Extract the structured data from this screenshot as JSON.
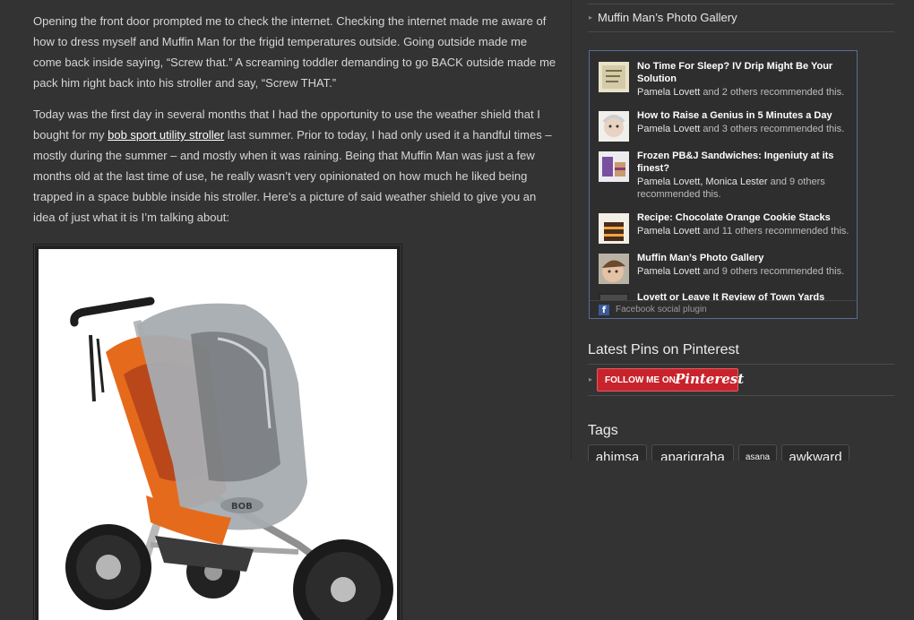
{
  "article": {
    "p1": "Opening the front door prompted me to check the internet.  Checking the internet made me aware of how to dress myself and Muffin Man for the frigid temperatures outside.  Going outside made me come back inside saying, “Screw that.” A screaming toddler demanding to go BACK outside made me pack him right back into his stroller and say, “Screw THAT.”",
    "p2_before": "Today was the first day in several months that I had the opportunity to use the weather shield that I bought for my ",
    "p2_link": "bob sport utility stroller",
    "p2_after": " last summer.  Prior to today, I had only used it a handful times – mostly during the summer – and mostly when it was raining.  Being that Muffin Man was just a few months old at the last time of use, he really wasn’t very opinionated on how much he liked being trapped in a space bubble inside his stroller.  Here’s a picture of said weather shield to give you an idea of just what it is I’m talking about:",
    "image_brand": "BOB"
  },
  "sidebar": {
    "top_link": "Muffin Man’s Photo Gallery",
    "facebook": {
      "items": [
        {
          "title": "No Time For Sleep? IV Drip Might Be Your Solution",
          "who": "Pamela Lovett",
          "rest": " and 2 others recommended this.",
          "thumb": "book-icon"
        },
        {
          "title": "How to Raise a Genius in 5 Minutes a Day",
          "who": "Pamela Lovett",
          "rest": " and 3 others recommended this.",
          "thumb": "baby-icon"
        },
        {
          "title": "Frozen PB&J Sandwiches: Ingeniuty at its finest?",
          "who": "Pamela Lovett, Monica Lester",
          "rest": " and 9 others recommended this.",
          "thumb": "food-icon"
        },
        {
          "title": "Recipe: Chocolate Orange Cookie Stacks",
          "who": "Pamela Lovett",
          "rest": " and 11 others recommended this.",
          "thumb": "cookie-icon"
        },
        {
          "title": "Muffin Man’s Photo Gallery",
          "who": "Pamela Lovett",
          "rest": " and 9 others recommended this.",
          "thumb": "child-icon"
        },
        {
          "title": "Lovett or Leave It Review of Town Yards",
          "who": "",
          "rest": "",
          "thumb": "photo-icon"
        }
      ],
      "footer_logo": "f",
      "footer_label": "Facebook social plugin"
    },
    "pinterest": {
      "title": "Latest Pins on Pinterest",
      "follow": "FOLLOW ME ON",
      "brand": "Pinterest"
    },
    "tags": {
      "title": "Tags",
      "items": [
        "ahimsa",
        "aparigraha",
        "asana",
        "awkward"
      ]
    }
  },
  "colors": {
    "background": "#333333",
    "text": "#d6d6d6",
    "facebook_border": "#5a6d96",
    "pinterest_red": "#c8232c"
  }
}
